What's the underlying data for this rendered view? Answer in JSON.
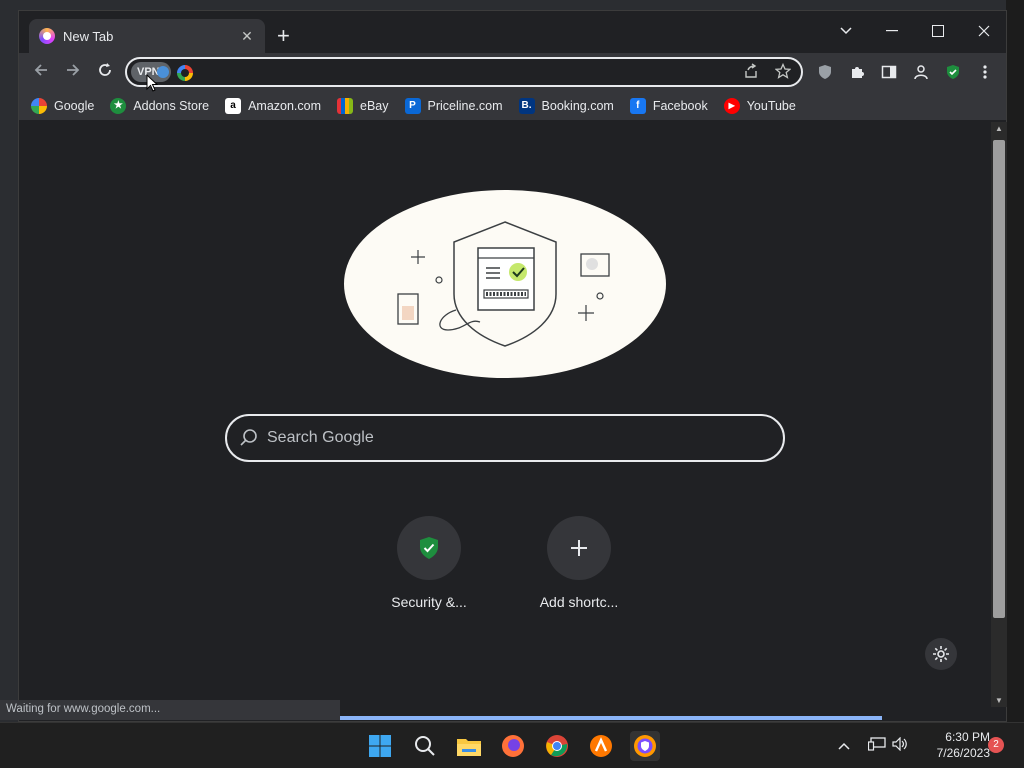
{
  "tab": {
    "title": "New Tab",
    "close": "✕",
    "new": "+"
  },
  "window_controls": {
    "minimize": "—",
    "maximize": "☐",
    "close": "✕",
    "tabsearch": "⌄"
  },
  "toolbar": {
    "vpn": "VPN"
  },
  "bookmarks": [
    {
      "label": "Google",
      "icon": "google-icon",
      "color": "#ffffff"
    },
    {
      "label": "Addons Store",
      "icon": "addons-store-icon",
      "color": "#1e8e3e"
    },
    {
      "label": "Amazon.com",
      "icon": "amazon-icon",
      "color": "#ffffff"
    },
    {
      "label": "eBay",
      "icon": "ebay-icon",
      "color": "#e53238"
    },
    {
      "label": "Priceline.com",
      "icon": "priceline-icon",
      "color": "#0a68d6"
    },
    {
      "label": "Booking.com",
      "icon": "booking-icon",
      "color": "#003580"
    },
    {
      "label": "Facebook",
      "icon": "facebook-icon",
      "color": "#1877f2"
    },
    {
      "label": "YouTube",
      "icon": "youtube-icon",
      "color": "#ff0000"
    }
  ],
  "search": {
    "placeholder": "Search Google"
  },
  "shortcuts": [
    {
      "label": "Security &...",
      "icon": "shield-check-icon"
    },
    {
      "label": "Add shortc...",
      "icon": "plus-icon"
    }
  ],
  "status": {
    "text": "Waiting for www.google.com..."
  },
  "taskbar": {
    "time": "6:30 PM",
    "date": "7/26/2023",
    "notifications": "2"
  },
  "colors": {
    "accent": "#8ab4f8",
    "shield": "#1e8e3e"
  }
}
